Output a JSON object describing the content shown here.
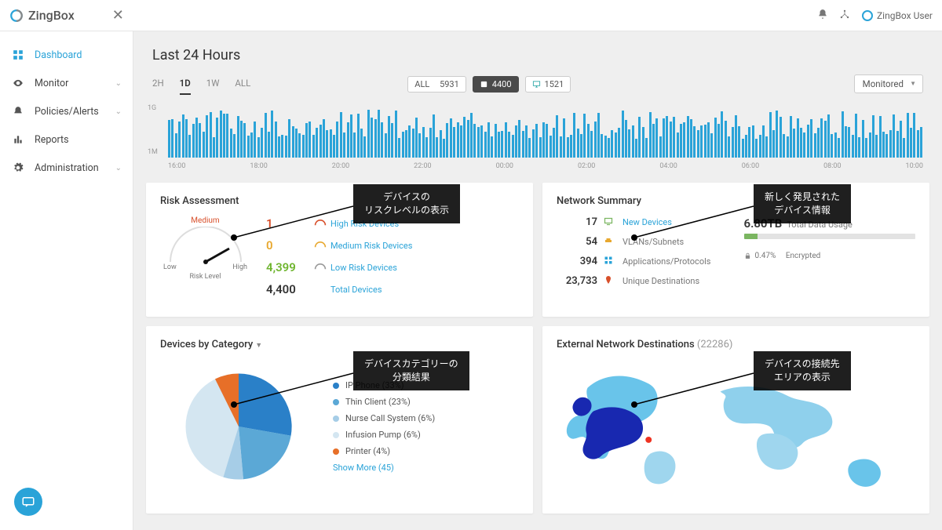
{
  "brand": "ZingBox",
  "user_label": "ZingBox User",
  "sidebar": {
    "items": [
      {
        "label": "Dashboard",
        "icon": "dashboard-icon",
        "active": true,
        "expandable": false
      },
      {
        "label": "Monitor",
        "icon": "eye-icon",
        "active": false,
        "expandable": true
      },
      {
        "label": "Policies/Alerts",
        "icon": "bell-icon",
        "active": false,
        "expandable": true
      },
      {
        "label": "Reports",
        "icon": "reports-icon",
        "active": false,
        "expandable": false
      },
      {
        "label": "Administration",
        "icon": "gear-icon",
        "active": false,
        "expandable": true
      }
    ]
  },
  "page_title": "Last 24 Hours",
  "time_tabs": [
    "2H",
    "1D",
    "1W",
    "ALL"
  ],
  "time_tab_active": "1D",
  "stat_pills": [
    {
      "label": "ALL",
      "value": "5931",
      "dark": false
    },
    {
      "label": "IoT",
      "value": "4400",
      "dark": true,
      "icon": "iot-icon"
    },
    {
      "label": "",
      "value": "1521",
      "dark": false,
      "icon": "desktop-icon"
    }
  ],
  "state_select": "Monitored",
  "spark_ylabels": [
    "1G",
    "1M"
  ],
  "spark_xticks": [
    "16:00",
    "18:00",
    "20:00",
    "22:00",
    "00:00",
    "02:00",
    "04:00",
    "06:00",
    "08:00",
    "10:00"
  ],
  "risk": {
    "title": "Risk Assessment",
    "gauge": {
      "top": "Medium",
      "left": "Low",
      "right": "High",
      "bottom": "Risk Level"
    },
    "rows": [
      {
        "cls": "high",
        "num": "1",
        "label": "High Risk Devices",
        "color": "#d84f2a"
      },
      {
        "cls": "med",
        "num": "0",
        "label": "Medium Risk Devices",
        "color": "#e8a82f"
      },
      {
        "cls": "low",
        "num": "4,399",
        "label": "Low Risk Devices",
        "color": "#999"
      },
      {
        "cls": "total",
        "num": "4,400",
        "label": "Total Devices",
        "color": "#333"
      }
    ]
  },
  "network": {
    "title": "Network Summary",
    "left": [
      {
        "num": "17",
        "label": "New Devices",
        "link": true,
        "icon_color": "#7bb661"
      },
      {
        "num": "54",
        "label": "VLANs/Subnets",
        "link": false,
        "icon_color": "#e8a82f"
      },
      {
        "num": "394",
        "label": "Applications/Protocols",
        "link": false,
        "icon_color": "#2aa3d8"
      },
      {
        "num": "23,733",
        "label": "Unique Destinations",
        "link": false,
        "icon_color": "#d84f2a"
      }
    ],
    "usage_value": "6.80TB",
    "usage_label": "Total Data Usage",
    "encrypted_value": "0.47%",
    "encrypted_label": "Encrypted"
  },
  "categories": {
    "title": "Devices by Category",
    "items": [
      {
        "label": "IP Phone (33%)",
        "color": "#2a80c8"
      },
      {
        "label": "Thin Client (23%)",
        "color": "#5ba8d6"
      },
      {
        "label": "Nurse Call System (6%)",
        "color": "#a6cde7"
      },
      {
        "label": "Infusion Pump (6%)",
        "color": "#d4e6f1"
      },
      {
        "label": "Printer (4%)",
        "color": "#e76f28"
      }
    ],
    "show_more": "Show More (45)"
  },
  "destinations": {
    "title_prefix": "External Network Destinations",
    "count": "(22286)"
  },
  "annotations": {
    "risk": "デバイスの\nリスクレベルの表示",
    "network": "新しく発見された\nデバイス情報",
    "categories": "デバイスカテゴリーの\n分類結果",
    "destinations": "デバイスの接続先\nエリアの表示"
  },
  "chart_data": [
    {
      "type": "bar",
      "name": "traffic-sparkline",
      "xlabel": "time",
      "ylabel": "bytes",
      "yticks": [
        "1M",
        "1G"
      ],
      "x_ticks": [
        "16:00",
        "18:00",
        "20:00",
        "22:00",
        "00:00",
        "02:00",
        "04:00",
        "06:00",
        "08:00",
        "10:00"
      ],
      "note": "Dense 24h bar sparkline. Values fluctuate roughly between 1M and ~1.5G.",
      "approx_values_range": [
        1000000,
        1500000000
      ]
    },
    {
      "type": "pie",
      "name": "devices-by-category",
      "slices": [
        {
          "label": "IP Phone",
          "pct": 33
        },
        {
          "label": "Thin Client",
          "pct": 23
        },
        {
          "label": "Nurse Call System",
          "pct": 6
        },
        {
          "label": "Infusion Pump",
          "pct": 6
        },
        {
          "label": "Printer",
          "pct": 4
        },
        {
          "label": "Other (45 more)",
          "pct": 28
        }
      ]
    },
    {
      "type": "map",
      "name": "external-destinations",
      "total": 22286,
      "note": "World choropleth, highest density in US (dark blue), light blue elsewhere, red marker on US east coast."
    }
  ]
}
